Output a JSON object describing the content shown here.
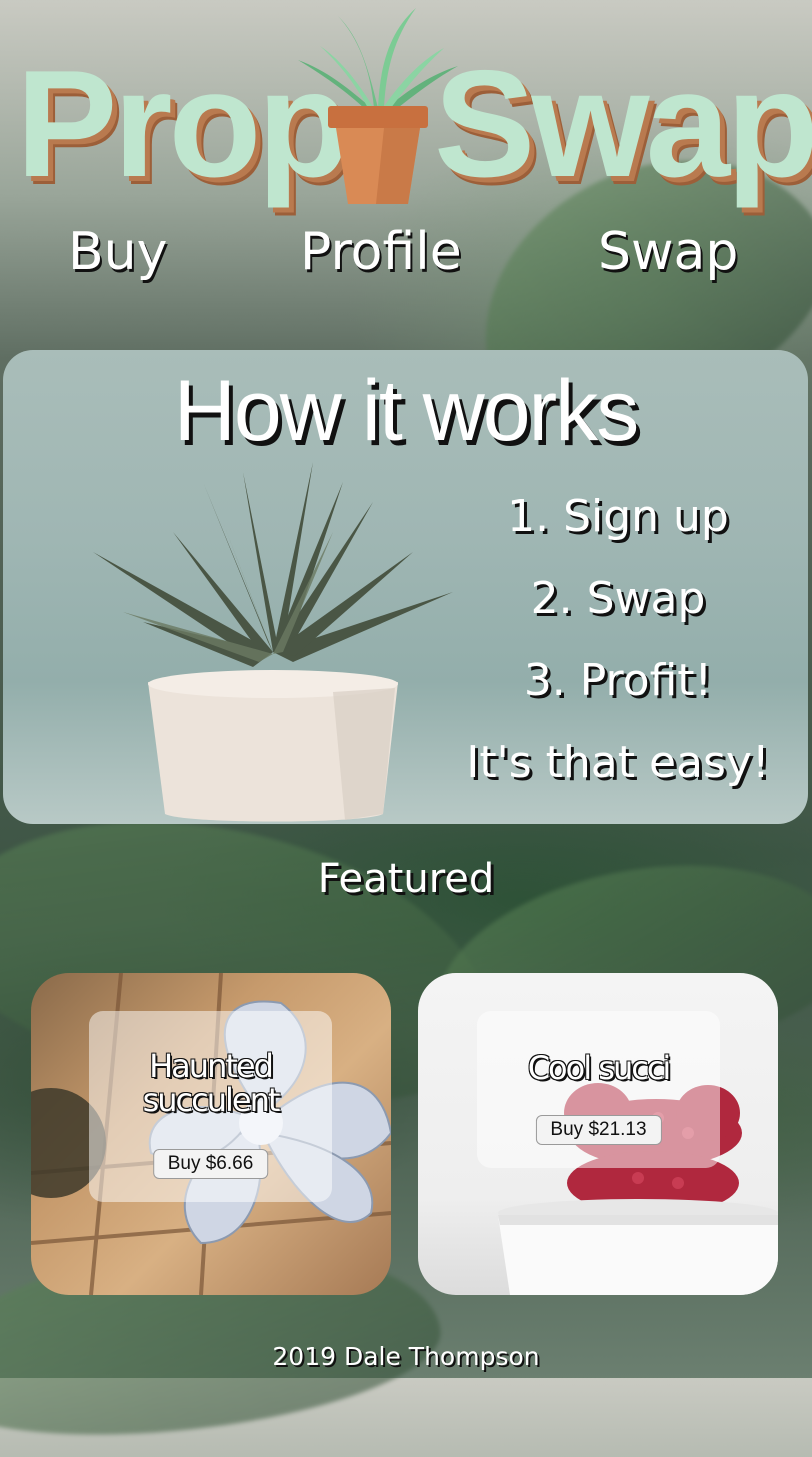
{
  "logo": {
    "left": "Prop",
    "right": "Swap"
  },
  "nav": {
    "items": [
      "Buy",
      "Profile",
      "Swap"
    ]
  },
  "how_it_works": {
    "title": "How it works",
    "steps": [
      "1. Sign up",
      "2. Swap",
      "3. Profit!",
      "It's that easy!"
    ]
  },
  "featured": {
    "title": "Featured",
    "cards": [
      {
        "name": "Haunted succulent",
        "button": "Buy $6.66"
      },
      {
        "name": "Cool succi",
        "button": "Buy $21.13"
      }
    ]
  },
  "footer": {
    "text": "2019 Dale Thompson"
  },
  "colors": {
    "logo_text": "#bfe6cf",
    "logo_shadow": "#b97a4f",
    "pot": "#d98a55",
    "leaf": "#6fbf88"
  }
}
